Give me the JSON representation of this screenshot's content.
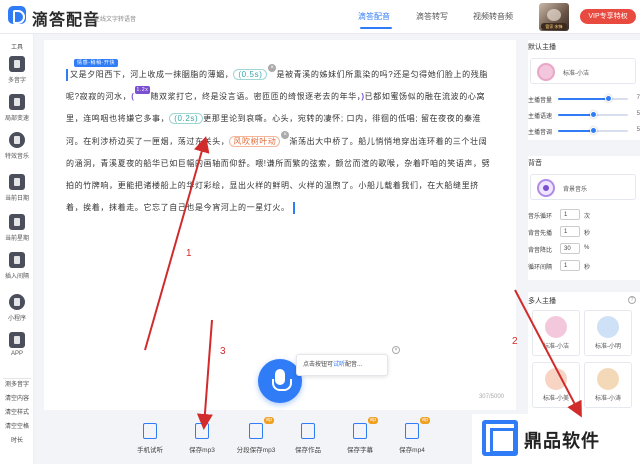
{
  "app": {
    "name": "滴答配音",
    "subtitle": "在线文字转语音"
  },
  "nav": {
    "items": [
      "滴答配音",
      "滴答转写",
      "视频转音频"
    ],
    "active": 0
  },
  "user": {
    "badge": "管家·宋锋",
    "vip_button": "VIP专享特权"
  },
  "left_sidebar": {
    "section": "工具",
    "items": [
      "多音字",
      "局部变速",
      "特效音乐",
      "当前日期",
      "当前星期",
      "插入间隔",
      "小程序",
      "APP"
    ],
    "footer": [
      "测多音字",
      "清空内容",
      "清空样式",
      "清空空格",
      "时长"
    ]
  },
  "editor": {
    "emotion_tag": "情感-稍稍-开快",
    "speed_tag": "1.2x",
    "para1": [
      "又是夕阳西下，河上收成一抹胭脂的薄媚，",
      "(0.5s)",
      "是被青溪的姊妹们所熏染的吗?还是匀得她们脸上的残脂呢?寂寂的河水，",
      "随双浆打它，",
      "终是没言语。密匝匝的绮恨逐老去的年华，",
      "已都如蜜饧似的融在流波的心窝里，连鸣咽也将嫌它多事，",
      "(0.2s)",
      "更那里论到哀嘶。心头，宛转的凄怀; 口内，徘徊的低唱; 留在夜夜的秦淮河。在利涉桥边买了一匣烟，荡过东关头，",
      "风吹树叶动",
      "渐荡出大中桥了。船儿悄悄地穿出连环着的三个壮阔的涵洞，青溪夏夜的船华已如巨幅的画轴而仰舒。喂!谦所而繁的弦索，颤岔而渲的歌喉，杂着吓咱的笑语声，劈拍的竹牌响，更能把诸楼船上的华灯彩绘，显出火样的鲜明、火样的温煦了。小船儿载着我们，在大船缝里挤着，挨着，抹着走。它忘了自己也是今宵河上的一星灯火。"
    ],
    "counter": "307/5000"
  },
  "tooltip": {
    "prefix": "点击按钮可",
    "highlight": "试听",
    "suffix": "配音..."
  },
  "bottom_toolbar": [
    {
      "label": "手机试听",
      "vip": false
    },
    {
      "label": "保存mp3",
      "vip": false
    },
    {
      "label": "分段保存mp3",
      "vip": true
    },
    {
      "label": "保存作品",
      "vip": false
    },
    {
      "label": "保存字幕",
      "vip": true
    },
    {
      "label": "保存mp4",
      "vip": true
    }
  ],
  "vip_label": "vip",
  "right_panel": {
    "default_voice": {
      "title": "默认主播",
      "name": "标准-小洁"
    },
    "sliders": [
      {
        "label": "主播音量",
        "value": 7,
        "fraction": 0.72
      },
      {
        "label": "主播语速",
        "value": 5,
        "fraction": 0.5
      },
      {
        "label": "主播音调",
        "value": 5,
        "fraction": 0.5
      }
    ],
    "background": {
      "title": "背音",
      "name": "背景音乐"
    },
    "bg_settings": [
      {
        "label": "音乐循环",
        "value": "1",
        "unit": "次"
      },
      {
        "label": "背音先播",
        "value": "1",
        "unit": "秒"
      },
      {
        "label": "背音降比",
        "value": "30",
        "unit": "%"
      },
      {
        "label": "循环间隔",
        "value": "1",
        "unit": "秒"
      }
    ],
    "multi": {
      "title": "多人主播",
      "voices": [
        "标准-小洁",
        "标准-小明",
        "标准-小美",
        "标准-小涛"
      ]
    }
  },
  "annotations": [
    "1",
    "2",
    "3"
  ],
  "watermark": "鼎品软件",
  "colors": {
    "accent": "#2f7cf6",
    "vip": "#e94a3f",
    "arrow": "#d12b2b"
  }
}
